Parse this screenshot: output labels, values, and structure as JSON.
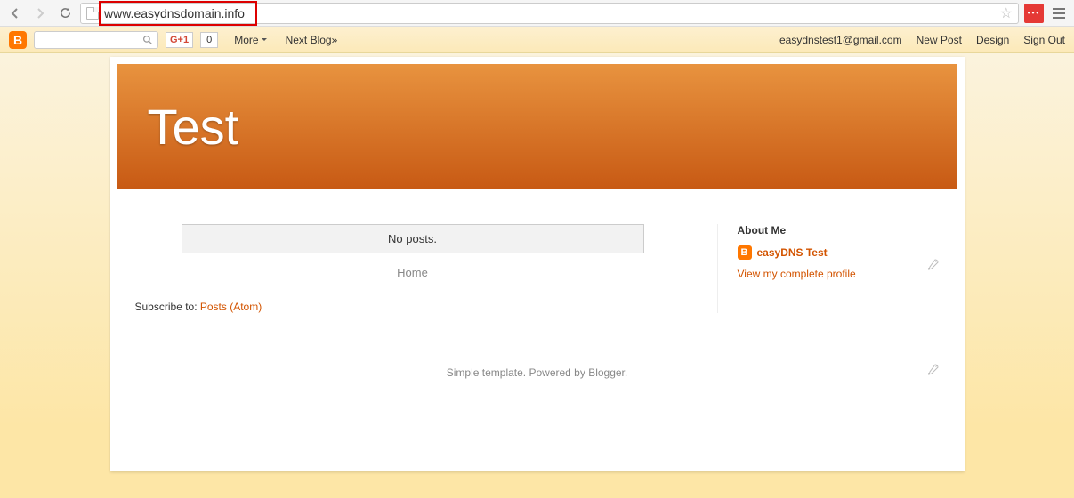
{
  "browser": {
    "url": "www.easydnsdomain.info"
  },
  "bloggerbar": {
    "gplus_label": "G+1",
    "gplus_count": "0",
    "more_label": "More",
    "next_blog_label": "Next Blog»",
    "email": "easydnstest1@gmail.com",
    "new_post": "New Post",
    "design": "Design",
    "sign_out": "Sign Out"
  },
  "header": {
    "title": "Test"
  },
  "main": {
    "no_posts": "No posts.",
    "home_label": "Home",
    "subscribe_prefix": "Subscribe to: ",
    "subscribe_link": "Posts (Atom)"
  },
  "sidebar": {
    "about_heading": "About Me",
    "profile_name": "easyDNS Test",
    "view_profile": "View my complete profile"
  },
  "footer": {
    "text_prefix": "Simple template. Powered by ",
    "blogger_label": "Blogger",
    "period": "."
  }
}
